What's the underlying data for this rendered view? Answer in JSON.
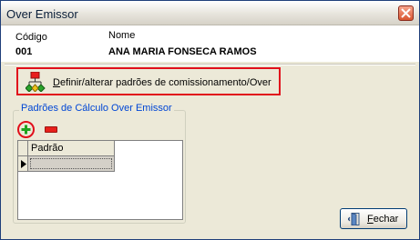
{
  "window": {
    "title": "Over Emissor"
  },
  "header": {
    "codigo_label": "Código",
    "codigo_value": "001",
    "nome_label": "Nome",
    "nome_value": "ANA MARIA FONSECA RAMOS"
  },
  "actions": {
    "define_link": {
      "first_letter": "D",
      "rest": "efinir/alterar padrões de comissionamento/Over",
      "icon": "hierarchy-icon"
    }
  },
  "group": {
    "title": "Padrões de Cálculo Over Emissor",
    "add_icon": "plus-icon",
    "remove_icon": "minus-icon",
    "grid": {
      "columns": [
        "Padrão"
      ],
      "rows": [
        [
          ""
        ]
      ]
    }
  },
  "footer": {
    "close": {
      "first_letter": "F",
      "rest": "echar",
      "icon": "door-exit-icon"
    }
  },
  "colors": {
    "highlight": "#e10f1b",
    "group_title": "#0046d5"
  }
}
